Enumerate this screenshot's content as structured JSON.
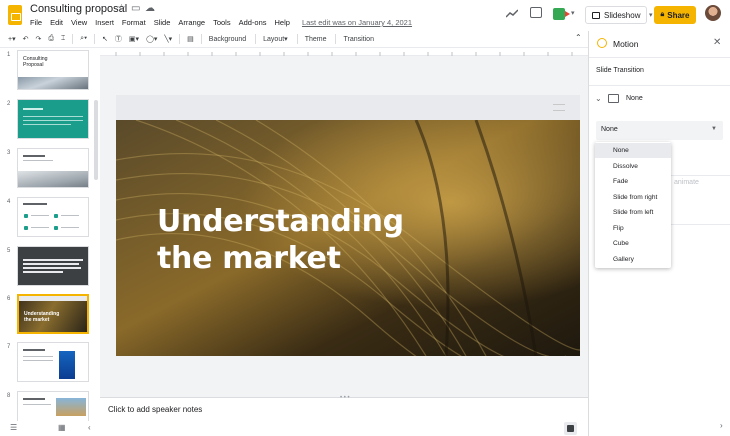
{
  "app": {
    "doc_title": "Consulting proposal",
    "menu": [
      "File",
      "Edit",
      "View",
      "Insert",
      "Format",
      "Slide",
      "Arrange",
      "Tools",
      "Add-ons",
      "Help"
    ],
    "last_edit": "Last edit was on January 4, 2021",
    "slideshow_label": "Slideshow",
    "share_label": "Share",
    "colors": {
      "accent": "#f4b400",
      "meet_green": "#34a853",
      "meet_red": "#ea4335"
    }
  },
  "toolbar": {
    "background_label": "Background",
    "layout_label": "Layout",
    "theme_label": "Theme",
    "transition_label": "Transition",
    "icons": [
      "add-icon",
      "undo-icon",
      "redo-icon",
      "print-icon",
      "paint-format-icon",
      "zoom-icon",
      "select-icon",
      "textbox-icon",
      "image-icon",
      "shape-icon",
      "line-icon",
      "comment-icon",
      "collapse-icon"
    ]
  },
  "filmstrip": {
    "selected_index": 6,
    "slides": [
      {
        "num": "1",
        "title": "Consulting Proposal"
      },
      {
        "num": "2",
        "title": ""
      },
      {
        "num": "3",
        "title": ""
      },
      {
        "num": "4",
        "title": ""
      },
      {
        "num": "5",
        "title": ""
      },
      {
        "num": "6",
        "title": "Understanding the market"
      },
      {
        "num": "7",
        "title": ""
      },
      {
        "num": "8",
        "title": ""
      }
    ]
  },
  "slide": {
    "title_line1": "Understanding",
    "title_line2": "the market"
  },
  "notes": {
    "placeholder": "Click to add speaker notes"
  },
  "panel": {
    "title": "Motion",
    "section": "Slide Transition",
    "current_transition": "None",
    "select_value": "None",
    "faded_label": "animate",
    "dropdown_options": [
      "None",
      "Dissolve",
      "Fade",
      "Slide from right",
      "Slide from left",
      "Flip",
      "Cube",
      "Gallery"
    ],
    "dropdown_active": "None"
  }
}
